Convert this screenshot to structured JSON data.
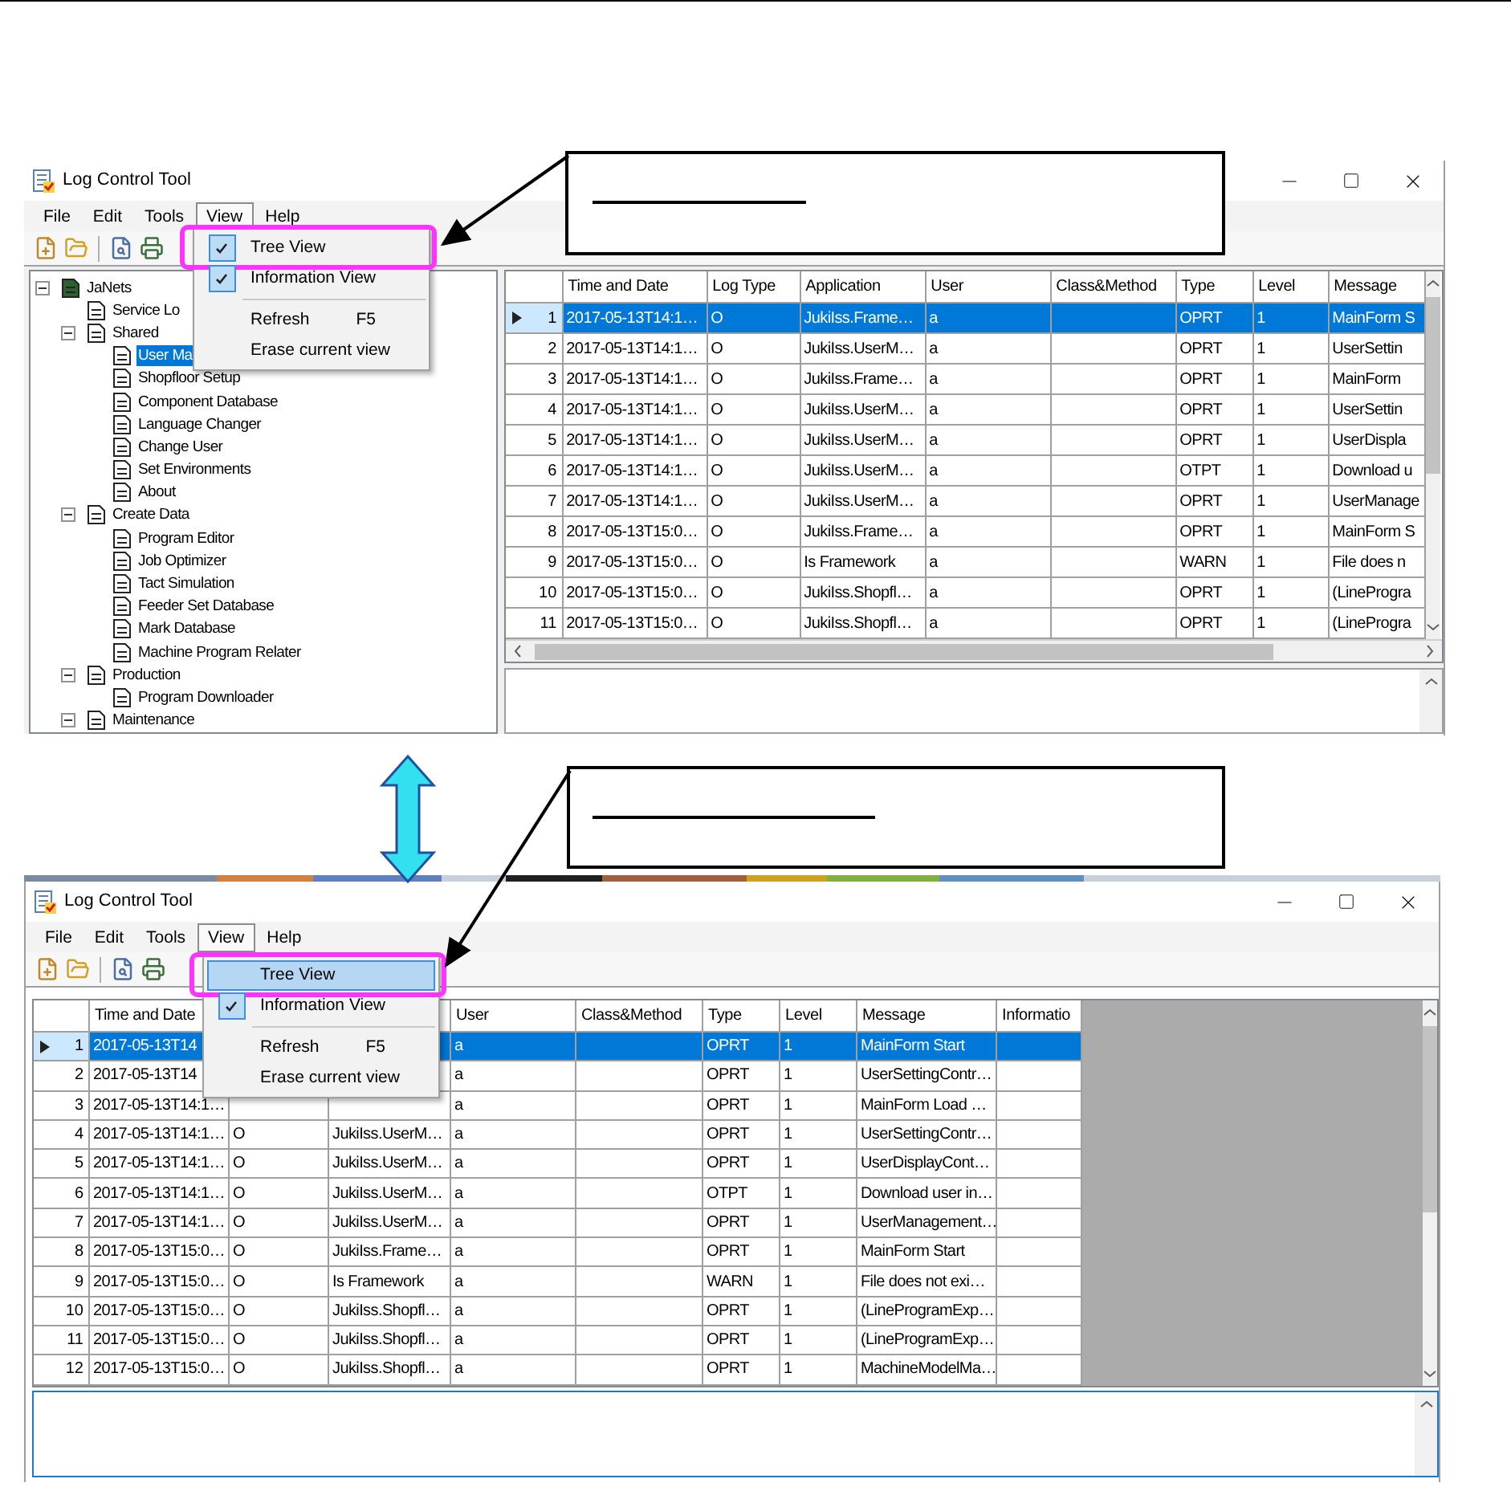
{
  "top_window": {
    "title": "Log Control Tool",
    "menu": [
      {
        "label": "File",
        "open": false
      },
      {
        "label": "Edit",
        "open": false
      },
      {
        "label": "Tools",
        "open": false
      },
      {
        "label": "View",
        "open": true
      },
      {
        "label": "Help",
        "open": false
      }
    ],
    "view_menu": [
      {
        "kind": "item",
        "label": "Tree View",
        "checked": true,
        "selected": false,
        "emphasized": true
      },
      {
        "kind": "item",
        "label": "Information View",
        "checked": true,
        "selected": false,
        "emphasized": false
      },
      {
        "kind": "separator"
      },
      {
        "kind": "item",
        "label": "Refresh",
        "shortcut": "F5",
        "checked": false,
        "selected": false,
        "emphasized": false
      },
      {
        "kind": "item",
        "label": "Erase current view",
        "checked": false,
        "selected": false,
        "emphasized": false
      }
    ],
    "tree": [
      {
        "label": "JaNets",
        "expanded": true,
        "selected": false,
        "children": [
          {
            "label": "Service Lo",
            "selected": false
          },
          {
            "label": "Shared",
            "expanded": true,
            "selected": false,
            "children": [
              {
                "label": "User Ma",
                "selected": true
              },
              {
                "label": "Shopfloor Setup",
                "selected": false
              },
              {
                "label": "Component Database",
                "selected": false
              },
              {
                "label": "Language Changer",
                "selected": false
              },
              {
                "label": "Change User",
                "selected": false
              },
              {
                "label": "Set Environments",
                "selected": false
              },
              {
                "label": "About",
                "selected": false
              }
            ]
          },
          {
            "label": "Create Data",
            "expanded": true,
            "selected": false,
            "children": [
              {
                "label": "Program Editor",
                "selected": false
              },
              {
                "label": "Job Optimizer",
                "selected": false
              },
              {
                "label": "Tact Simulation",
                "selected": false
              },
              {
                "label": "Feeder Set Database",
                "selected": false
              },
              {
                "label": "Mark Database",
                "selected": false
              },
              {
                "label": "Machine Program Relater",
                "selected": false
              }
            ]
          },
          {
            "label": "Production",
            "expanded": true,
            "selected": false,
            "children": [
              {
                "label": "Program Downloader",
                "selected": false
              }
            ]
          },
          {
            "label": "Maintenance",
            "expanded": true,
            "selected": false
          }
        ]
      }
    ],
    "grid": {
      "columns": [
        {
          "label": "Time and Date"
        },
        {
          "label": "Log Type"
        },
        {
          "label": "Application"
        },
        {
          "label": "User"
        },
        {
          "label": "Class&Method"
        },
        {
          "label": "Type"
        },
        {
          "label": "Level"
        },
        {
          "label": "Message"
        }
      ],
      "rows": [
        {
          "number": "1",
          "selected": true,
          "time": "2017-05-13T14:1…",
          "log_type": "O",
          "application": "JukiIss.Frame…",
          "user": "a",
          "type": "OPRT",
          "level": "1",
          "message": "MainForm S"
        },
        {
          "number": "2",
          "selected": false,
          "time": "2017-05-13T14:1…",
          "log_type": "O",
          "application": "JukiIss.UserM…",
          "user": "a",
          "type": "OPRT",
          "level": "1",
          "message": "UserSettin"
        },
        {
          "number": "3",
          "selected": false,
          "time": "2017-05-13T14:1…",
          "log_type": "O",
          "application": "JukiIss.Frame…",
          "user": "a",
          "type": "OPRT",
          "level": "1",
          "message": "MainForm"
        },
        {
          "number": "4",
          "selected": false,
          "time": "2017-05-13T14:1…",
          "log_type": "O",
          "application": "JukiIss.UserM…",
          "user": "a",
          "type": "OPRT",
          "level": "1",
          "message": "UserSettin"
        },
        {
          "number": "5",
          "selected": false,
          "time": "2017-05-13T14:1…",
          "log_type": "O",
          "application": "JukiIss.UserM…",
          "user": "a",
          "type": "OPRT",
          "level": "1",
          "message": "UserDispla"
        },
        {
          "number": "6",
          "selected": false,
          "time": "2017-05-13T14:1…",
          "log_type": "O",
          "application": "JukiIss.UserM…",
          "user": "a",
          "type": "OTPT",
          "level": "1",
          "message": "Download u"
        },
        {
          "number": "7",
          "selected": false,
          "time": "2017-05-13T14:1…",
          "log_type": "O",
          "application": "JukiIss.UserM…",
          "user": "a",
          "type": "OPRT",
          "level": "1",
          "message": "UserManage"
        },
        {
          "number": "8",
          "selected": false,
          "time": "2017-05-13T15:0…",
          "log_type": "O",
          "application": "JukiIss.Frame…",
          "user": "a",
          "type": "OPRT",
          "level": "1",
          "message": "MainForm S"
        },
        {
          "number": "9",
          "selected": false,
          "time": "2017-05-13T15:0…",
          "log_type": "O",
          "application": "Is Framework",
          "user": "a",
          "type": "WARN",
          "level": "1",
          "message": "File does n"
        },
        {
          "number": "10",
          "selected": false,
          "time": "2017-05-13T15:0…",
          "log_type": "O",
          "application": "JukiIss.Shopfl…",
          "user": "a",
          "type": "OPRT",
          "level": "1",
          "message": "(LineProgra"
        },
        {
          "number": "11",
          "selected": false,
          "time": "2017-05-13T15:0…",
          "log_type": "O",
          "application": "JukiIss.Shopfl…",
          "user": "a",
          "type": "OPRT",
          "level": "1",
          "message": "(LineProgra"
        }
      ]
    }
  },
  "bottom_window": {
    "title": "Log Control Tool",
    "menu": [
      {
        "label": "File",
        "open": false
      },
      {
        "label": "Edit",
        "open": false
      },
      {
        "label": "Tools",
        "open": false
      },
      {
        "label": "View",
        "open": true
      },
      {
        "label": "Help",
        "open": false
      }
    ],
    "view_menu": [
      {
        "kind": "item",
        "label": "Tree View",
        "checked": false,
        "selected": true,
        "emphasized": true
      },
      {
        "kind": "item",
        "label": "Information View",
        "checked": true,
        "selected": false,
        "emphasized": false
      },
      {
        "kind": "separator"
      },
      {
        "kind": "item",
        "label": "Refresh",
        "shortcut": "F5",
        "checked": false,
        "selected": false,
        "emphasized": false
      },
      {
        "kind": "item",
        "label": "Erase current view",
        "checked": false,
        "selected": false,
        "emphasized": false
      }
    ],
    "grid": {
      "columns": [
        {
          "label": "Time and Date"
        },
        {},
        {},
        {
          "label": "User"
        },
        {
          "label": "Class&Method"
        },
        {
          "label": "Type"
        },
        {
          "label": "Level"
        },
        {
          "label": "Message"
        },
        {
          "label": "Informatio"
        }
      ],
      "rows": [
        {
          "number": "1",
          "selected": true,
          "time": "2017-05-13T14",
          "user": "a",
          "type": "OPRT",
          "level": "1",
          "message": "MainForm Start"
        },
        {
          "number": "2",
          "selected": false,
          "time": "2017-05-13T14",
          "user": "a",
          "type": "OPRT",
          "level": "1",
          "message": "UserSettingContr…"
        },
        {
          "number": "3",
          "selected": false,
          "time": "2017-05-13T14:1…",
          "user": "a",
          "type": "OPRT",
          "level": "1",
          "message": "MainForm Load …"
        },
        {
          "number": "4",
          "selected": false,
          "time": "2017-05-13T14:1…",
          "log_type": "O",
          "application": "JukiIss.UserM…",
          "user": "a",
          "type": "OPRT",
          "level": "1",
          "message": "UserSettingContr…"
        },
        {
          "number": "5",
          "selected": false,
          "time": "2017-05-13T14:1…",
          "log_type": "O",
          "application": "JukiIss.UserM…",
          "user": "a",
          "type": "OPRT",
          "level": "1",
          "message": "UserDisplayCont…"
        },
        {
          "number": "6",
          "selected": false,
          "time": "2017-05-13T14:1…",
          "log_type": "O",
          "application": "JukiIss.UserM…",
          "user": "a",
          "type": "OTPT",
          "level": "1",
          "message": "Download user in…"
        },
        {
          "number": "7",
          "selected": false,
          "time": "2017-05-13T14:1…",
          "log_type": "O",
          "application": "JukiIss.UserM…",
          "user": "a",
          "type": "OPRT",
          "level": "1",
          "message": "UserManagement…"
        },
        {
          "number": "8",
          "selected": false,
          "time": "2017-05-13T15:0…",
          "log_type": "O",
          "application": "JukiIss.Frame…",
          "user": "a",
          "type": "OPRT",
          "level": "1",
          "message": "MainForm Start"
        },
        {
          "number": "9",
          "selected": false,
          "time": "2017-05-13T15:0…",
          "log_type": "O",
          "application": "Is Framework",
          "user": "a",
          "type": "WARN",
          "level": "1",
          "message": "File does not exi…"
        },
        {
          "number": "10",
          "selected": false,
          "time": "2017-05-13T15:0…",
          "log_type": "O",
          "application": "JukiIss.Shopfl…",
          "user": "a",
          "type": "OPRT",
          "level": "1",
          "message": "(LineProgramExp…"
        },
        {
          "number": "11",
          "selected": false,
          "time": "2017-05-13T15:0…",
          "log_type": "O",
          "application": "JukiIss.Shopfl…",
          "user": "a",
          "type": "OPRT",
          "level": "1",
          "message": "(LineProgramExp…"
        },
        {
          "number": "12",
          "selected": false,
          "time": "2017-05-13T15:0…",
          "log_type": "O",
          "application": "JukiIss.Shopfl…",
          "user": "a",
          "type": "OPRT",
          "level": "1",
          "message": "MachineModelMa…"
        }
      ]
    }
  }
}
